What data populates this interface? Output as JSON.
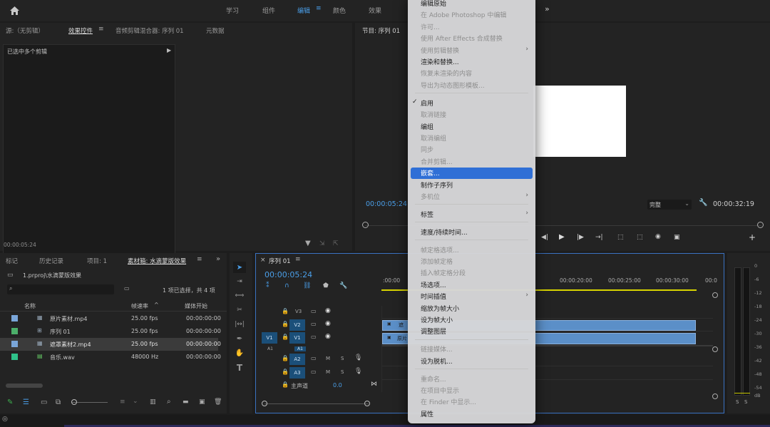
{
  "workspaces": [
    "学习",
    "组件",
    "编辑",
    "颜色",
    "效果"
  ],
  "source_panel": {
    "tabs": [
      "源:（无剪辑）",
      "效果控件",
      "音频剪辑混合器: 序列 01",
      "元数据"
    ],
    "content_label": "已选中多个剪辑",
    "timecode": "00:00:05:24"
  },
  "program_panel": {
    "title": "节目: 序列 01",
    "timecode_left": "00:00:05:24",
    "quality": "完整",
    "timecode_right": "00:00:32:19"
  },
  "project_panel": {
    "tabs": [
      "标记",
      "历史记录",
      "项目: 1",
      "素材箱: 水滴蒙版效果"
    ],
    "path": "1.prproj\\水滴蒙版效果",
    "selection_info": "1 项已选择，共 4 项",
    "columns": [
      "名称",
      "帧速率",
      "媒体开始"
    ],
    "rows": [
      {
        "name": "原片素材.mp4",
        "fps": "25.00 fps",
        "start": "00:00:00:00",
        "color": "#7aa6d9"
      },
      {
        "name": "序列 01",
        "fps": "25.00 fps",
        "start": "00:00:00:00",
        "color": "#4caf6a"
      },
      {
        "name": "遮罩素材2.mp4",
        "fps": "25.00 fps",
        "start": "00:00:00:00",
        "color": "#7aa6d9"
      },
      {
        "name": "音乐.wav",
        "fps": "48000 Hz",
        "start": "00:00:00:00",
        "color": "#2fc28a"
      }
    ]
  },
  "timeline": {
    "tab": "序列 01",
    "timecode": "00:00:05:24",
    "ruler": [
      ":00:00",
      "00:00:20:00",
      "00:00:25:00",
      "00:00:30:00",
      "00:0"
    ],
    "video_tracks": [
      "V3",
      "V2",
      "V1"
    ],
    "audio_tracks": [
      "A1",
      "A2",
      "A3"
    ],
    "source_patch_v": "V1",
    "source_patch_a": "A1",
    "master": {
      "label": "主声道",
      "value": "0.0"
    },
    "audio_btn_m": "M",
    "audio_btn_s": "S",
    "clip_v2": "遮",
    "clip_v1": "原片"
  },
  "meter": {
    "scale": [
      "0",
      "-6",
      "-12",
      "-18",
      "-24",
      "-30",
      "-36",
      "-42",
      "-48",
      "-54",
      "dB"
    ],
    "solo": [
      "S",
      "S"
    ]
  },
  "context_menu": {
    "items": [
      {
        "label": "编辑原始",
        "enabled": true,
        "sep": false
      },
      {
        "label": "在 Adobe Photoshop 中编辑",
        "enabled": false,
        "sep": false
      },
      {
        "label": "许可...",
        "enabled": false,
        "sep": false
      },
      {
        "label": "使用 After Effects 合成替换",
        "enabled": false,
        "sep": false
      },
      {
        "label": "使用剪辑替换",
        "enabled": false,
        "sep": false,
        "sub": true
      },
      {
        "label": "渲染和替换...",
        "enabled": true,
        "sep": false
      },
      {
        "label": "恢复未渲染的内容",
        "enabled": false,
        "sep": false
      },
      {
        "label": "导出为动态图形模板...",
        "enabled": false,
        "sep": true
      },
      {
        "label": "启用",
        "enabled": true,
        "check": true,
        "sep": false
      },
      {
        "label": "取消链接",
        "enabled": false,
        "sep": false
      },
      {
        "label": "编组",
        "enabled": true,
        "sep": false
      },
      {
        "label": "取消编组",
        "enabled": false,
        "sep": false
      },
      {
        "label": "同步",
        "enabled": false,
        "sep": false
      },
      {
        "label": "合并剪辑...",
        "enabled": false,
        "sep": false
      },
      {
        "label": "嵌套...",
        "enabled": true,
        "highlight": true,
        "sep": false
      },
      {
        "label": "制作子序列",
        "enabled": true,
        "sep": false
      },
      {
        "label": "多机位",
        "enabled": false,
        "sub": true,
        "sep": true
      },
      {
        "label": "标签",
        "enabled": true,
        "sub": true,
        "sep": true
      },
      {
        "label": "速度/持续时间...",
        "enabled": true,
        "sep": true
      },
      {
        "label": "帧定格选项...",
        "enabled": false,
        "sep": false
      },
      {
        "label": "添加帧定格",
        "enabled": false,
        "sep": false
      },
      {
        "label": "插入帧定格分段",
        "enabled": false,
        "sep": false
      },
      {
        "label": "场选项...",
        "enabled": true,
        "sep": false
      },
      {
        "label": "时间插值",
        "enabled": true,
        "sub": true,
        "sep": false
      },
      {
        "label": "缩放为帧大小",
        "enabled": true,
        "sep": false
      },
      {
        "label": "设为帧大小",
        "enabled": true,
        "sep": false
      },
      {
        "label": "调整图层",
        "enabled": true,
        "sep": true
      },
      {
        "label": "链接媒体...",
        "enabled": false,
        "sep": false
      },
      {
        "label": "设为脱机...",
        "enabled": true,
        "sep": true
      },
      {
        "label": "重命名...",
        "enabled": false,
        "sep": false
      },
      {
        "label": "在项目中显示",
        "enabled": false,
        "sep": false
      },
      {
        "label": "在 Finder 中显示...",
        "enabled": false,
        "sep": false
      },
      {
        "label": "属性",
        "enabled": true,
        "sep": false
      }
    ]
  }
}
